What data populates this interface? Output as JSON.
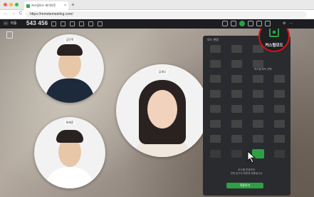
{
  "browser": {
    "tab_title": "커스텀모드 레이아웃",
    "tab_close": "×",
    "new_tab": "+",
    "nav": [
      "←",
      "→",
      "C"
    ],
    "url": "https://remotemeeting.com/"
  },
  "toolbar": {
    "room_badge": "01",
    "room_label": "자동",
    "room_id": "543 456"
  },
  "participants": [
    {
      "name": "김민혁"
    },
    {
      "name": "김세나"
    },
    {
      "name": "최재준"
    }
  ],
  "panel": {
    "title": "모드 변경",
    "sub_label": "커스텀 모드 선택",
    "footer_text_1": "모드를 변경하면,",
    "footer_text_2": "전체 참가자 화면에 적용됩니다.",
    "apply_label": "적용하기"
  },
  "custom_mode": {
    "label": "커스텀모드"
  },
  "colors": {
    "accent": "#2ea043",
    "highlight_ring": "#dd1111",
    "panel_bg": "#2a2b2f",
    "toolbar_bg": "#1c1d20"
  }
}
